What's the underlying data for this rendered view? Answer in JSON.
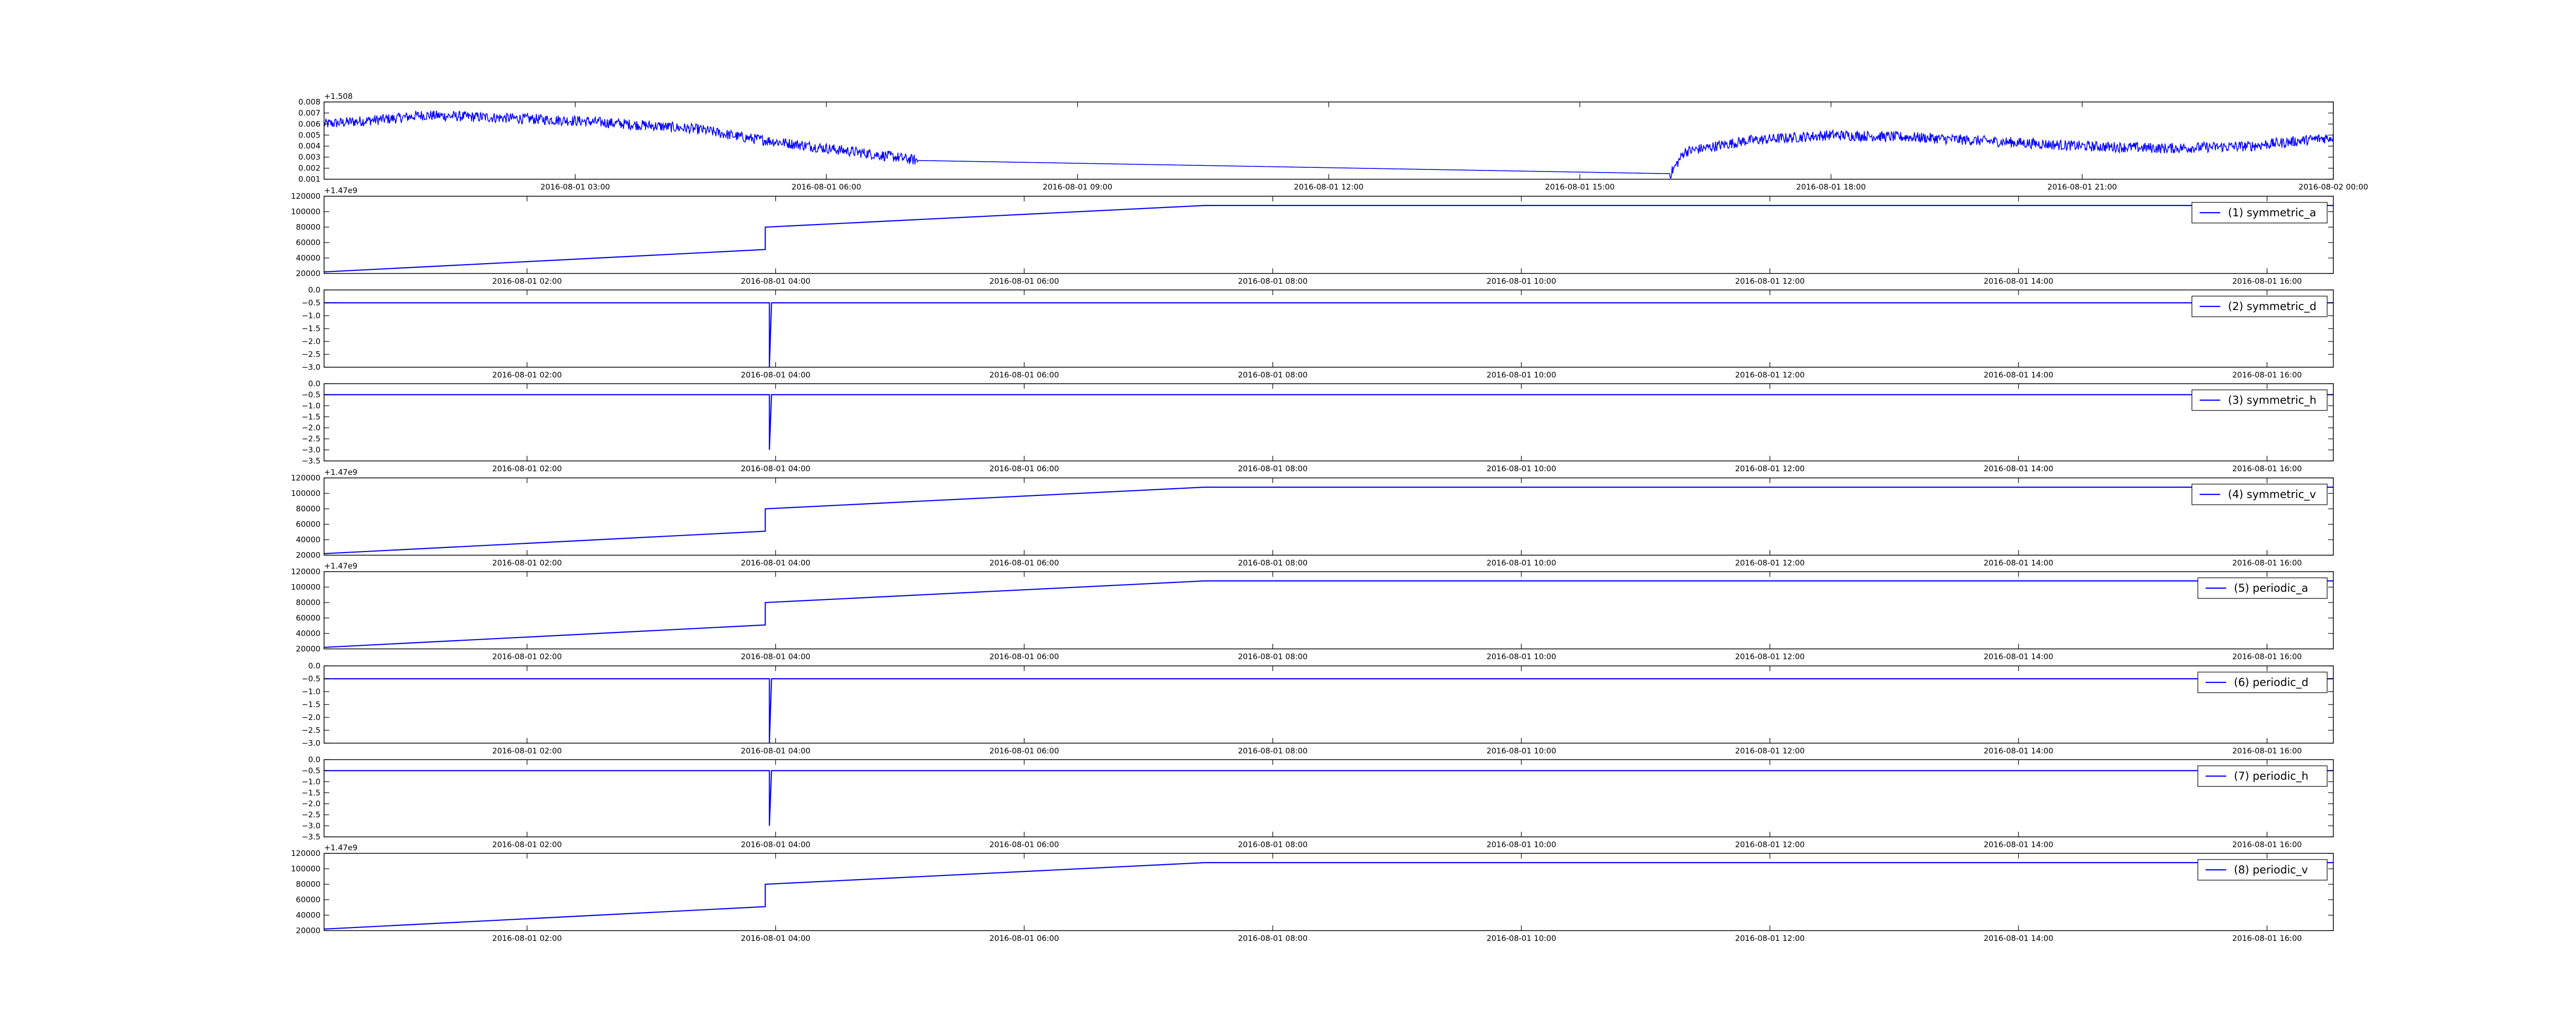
{
  "page": {
    "background": "#ffffff"
  },
  "style": {
    "line_color": "#0000ff",
    "axes_color": "#000000"
  },
  "chart_data": [
    {
      "type": "line",
      "y_offset_label": "+1.508",
      "ylim": [
        0.001,
        0.008
      ],
      "yticks": [
        0.001,
        0.002,
        0.003,
        0.004,
        0.005,
        0.006,
        0.007,
        0.008
      ],
      "ytick_labels": [
        "0.001",
        "0.002",
        "0.003",
        "0.004",
        "0.005",
        "0.006",
        "0.007",
        "0.008"
      ],
      "xlim": [
        "2016-08-01T00:00",
        "2016-08-02T00:00"
      ],
      "xticks": [
        "2016-08-01T03:00",
        "2016-08-01T06:00",
        "2016-08-01T09:00",
        "2016-08-01T12:00",
        "2016-08-01T15:00",
        "2016-08-01T18:00",
        "2016-08-01T21:00",
        "2016-08-02T00:00"
      ],
      "xtick_labels": [
        "2016-08-01 03:00",
        "2016-08-01 06:00",
        "2016-08-01 09:00",
        "2016-08-01 12:00",
        "2016-08-01 15:00",
        "2016-08-01 18:00",
        "2016-08-01 21:00",
        "2016-08-02 00:00"
      ],
      "noisy": true,
      "noise_amplitude": 0.0006,
      "points": [
        [
          "2016-08-01T00:00",
          0.006
        ],
        [
          "2016-08-01T00:50",
          0.0065
        ],
        [
          "2016-08-01T01:10",
          0.0068
        ],
        [
          "2016-08-01T02:00",
          0.0066
        ],
        [
          "2016-08-01T03:00",
          0.0063
        ],
        [
          "2016-08-01T04:00",
          0.0058
        ],
        [
          "2016-08-01T04:30",
          0.0055
        ],
        [
          "2016-08-01T05:00",
          0.0048
        ],
        [
          "2016-08-01T06:00",
          0.0038
        ],
        [
          "2016-08-01T06:50",
          0.003
        ],
        [
          "2016-08-01T07:05",
          0.0027
        ],
        [
          "2016-08-01T16:05",
          0.0015
        ],
        [
          "2016-08-01T16:15",
          0.0035
        ],
        [
          "2016-08-01T17:00",
          0.0045
        ],
        [
          "2016-08-01T18:00",
          0.005
        ],
        [
          "2016-08-01T19:00",
          0.0048
        ],
        [
          "2016-08-01T20:00",
          0.0044
        ],
        [
          "2016-08-01T21:00",
          0.004
        ],
        [
          "2016-08-01T22:00",
          0.0038
        ],
        [
          "2016-08-01T23:00",
          0.004
        ],
        [
          "2016-08-02T00:00",
          0.0048
        ]
      ],
      "flat_segment": [
        "2016-08-01T07:05",
        "2016-08-01T16:05"
      ]
    },
    {
      "type": "line",
      "legend": "(1) symmetric_a",
      "y_offset_label": "+1.47e9",
      "ylim": [
        20000,
        120000
      ],
      "yticks": [
        20000,
        40000,
        60000,
        80000,
        100000,
        120000
      ],
      "ytick_labels": [
        "20000",
        "40000",
        "60000",
        "80000",
        "100000",
        "120000"
      ],
      "xlim": [
        "2016-08-01T00:22",
        "2016-08-01T16:32"
      ],
      "xticks": [
        "2016-08-01T02:00",
        "2016-08-01T04:00",
        "2016-08-01T06:00",
        "2016-08-01T08:00",
        "2016-08-01T10:00",
        "2016-08-01T12:00",
        "2016-08-01T14:00",
        "2016-08-01T16:00"
      ],
      "xtick_labels": [
        "2016-08-01 02:00",
        "2016-08-01 04:00",
        "2016-08-01 06:00",
        "2016-08-01 08:00",
        "2016-08-01 10:00",
        "2016-08-01 12:00",
        "2016-08-01 14:00",
        "2016-08-01 16:00"
      ],
      "points": [
        [
          "2016-08-01T00:22",
          22000
        ],
        [
          "2016-08-01T03:55",
          51000
        ],
        [
          "2016-08-01T03:55",
          80000
        ],
        [
          "2016-08-01T07:27",
          108000
        ],
        [
          "2016-08-01T16:32",
          108000
        ]
      ]
    },
    {
      "type": "line",
      "legend": "(2) symmetric_d",
      "ylim": [
        -3.0,
        0.0
      ],
      "yticks": [
        0.0,
        -0.5,
        -1.0,
        -1.5,
        -2.0,
        -2.5,
        -3.0
      ],
      "ytick_labels": [
        "0.0",
        "−0.5",
        "−1.0",
        "−1.5",
        "−2.0",
        "−2.5",
        "−3.0"
      ],
      "xlim": [
        "2016-08-01T00:22",
        "2016-08-01T16:32"
      ],
      "xticks": [
        "2016-08-01T02:00",
        "2016-08-01T04:00",
        "2016-08-01T06:00",
        "2016-08-01T08:00",
        "2016-08-01T10:00",
        "2016-08-01T12:00",
        "2016-08-01T14:00",
        "2016-08-01T16:00"
      ],
      "xtick_labels": [
        "2016-08-01 02:00",
        "2016-08-01 04:00",
        "2016-08-01 06:00",
        "2016-08-01 08:00",
        "2016-08-01 10:00",
        "2016-08-01 12:00",
        "2016-08-01 14:00",
        "2016-08-01 16:00"
      ],
      "points": [
        [
          "2016-08-01T00:22",
          -0.5
        ],
        [
          "2016-08-01T03:57",
          -0.5
        ],
        [
          "2016-08-01T03:57",
          -3.0
        ],
        [
          "2016-08-01T03:58",
          -0.5
        ],
        [
          "2016-08-01T16:32",
          -0.5
        ]
      ]
    },
    {
      "type": "line",
      "legend": "(3) symmetric_h",
      "ylim": [
        -3.5,
        0.0
      ],
      "yticks": [
        0.0,
        -0.5,
        -1.0,
        -1.5,
        -2.0,
        -2.5,
        -3.0,
        -3.5
      ],
      "ytick_labels": [
        "0.0",
        "−0.5",
        "−1.0",
        "−1.5",
        "−2.0",
        "−2.5",
        "−3.0",
        "−3.5"
      ],
      "xlim": [
        "2016-08-01T00:22",
        "2016-08-01T16:32"
      ],
      "xticks": [
        "2016-08-01T02:00",
        "2016-08-01T04:00",
        "2016-08-01T06:00",
        "2016-08-01T08:00",
        "2016-08-01T10:00",
        "2016-08-01T12:00",
        "2016-08-01T14:00",
        "2016-08-01T16:00"
      ],
      "xtick_labels": [
        "2016-08-01 02:00",
        "2016-08-01 04:00",
        "2016-08-01 06:00",
        "2016-08-01 08:00",
        "2016-08-01 10:00",
        "2016-08-01 12:00",
        "2016-08-01 14:00",
        "2016-08-01 16:00"
      ],
      "points": [
        [
          "2016-08-01T00:22",
          -0.5
        ],
        [
          "2016-08-01T03:57",
          -0.5
        ],
        [
          "2016-08-01T03:57",
          -3.0
        ],
        [
          "2016-08-01T03:58",
          -0.5
        ],
        [
          "2016-08-01T16:32",
          -0.5
        ]
      ]
    },
    {
      "type": "line",
      "legend": "(4) symmetric_v",
      "y_offset_label": "+1.47e9",
      "ylim": [
        20000,
        120000
      ],
      "yticks": [
        20000,
        40000,
        60000,
        80000,
        100000,
        120000
      ],
      "ytick_labels": [
        "20000",
        "40000",
        "60000",
        "80000",
        "100000",
        "120000"
      ],
      "xlim": [
        "2016-08-01T00:22",
        "2016-08-01T16:32"
      ],
      "xticks": [
        "2016-08-01T02:00",
        "2016-08-01T04:00",
        "2016-08-01T06:00",
        "2016-08-01T08:00",
        "2016-08-01T10:00",
        "2016-08-01T12:00",
        "2016-08-01T14:00",
        "2016-08-01T16:00"
      ],
      "xtick_labels": [
        "2016-08-01 02:00",
        "2016-08-01 04:00",
        "2016-08-01 06:00",
        "2016-08-01 08:00",
        "2016-08-01 10:00",
        "2016-08-01 12:00",
        "2016-08-01 14:00",
        "2016-08-01 16:00"
      ],
      "points": [
        [
          "2016-08-01T00:22",
          22000
        ],
        [
          "2016-08-01T03:55",
          51000
        ],
        [
          "2016-08-01T03:55",
          80000
        ],
        [
          "2016-08-01T07:27",
          108000
        ],
        [
          "2016-08-01T16:32",
          108000
        ]
      ]
    },
    {
      "type": "line",
      "legend": "(5) periodic_a",
      "y_offset_label": "+1.47e9",
      "ylim": [
        20000,
        120000
      ],
      "yticks": [
        20000,
        40000,
        60000,
        80000,
        100000,
        120000
      ],
      "ytick_labels": [
        "20000",
        "40000",
        "60000",
        "80000",
        "100000",
        "120000"
      ],
      "xlim": [
        "2016-08-01T00:22",
        "2016-08-01T16:32"
      ],
      "xticks": [
        "2016-08-01T02:00",
        "2016-08-01T04:00",
        "2016-08-01T06:00",
        "2016-08-01T08:00",
        "2016-08-01T10:00",
        "2016-08-01T12:00",
        "2016-08-01T14:00",
        "2016-08-01T16:00"
      ],
      "xtick_labels": [
        "2016-08-01 02:00",
        "2016-08-01 04:00",
        "2016-08-01 06:00",
        "2016-08-01 08:00",
        "2016-08-01 10:00",
        "2016-08-01 12:00",
        "2016-08-01 14:00",
        "2016-08-01 16:00"
      ],
      "points": [
        [
          "2016-08-01T00:22",
          22000
        ],
        [
          "2016-08-01T03:55",
          51000
        ],
        [
          "2016-08-01T03:55",
          80000
        ],
        [
          "2016-08-01T07:27",
          108000
        ],
        [
          "2016-08-01T16:32",
          108000
        ]
      ]
    },
    {
      "type": "line",
      "legend": "(6) periodic_d",
      "ylim": [
        -3.0,
        0.0
      ],
      "yticks": [
        0.0,
        -0.5,
        -1.0,
        -1.5,
        -2.0,
        -2.5,
        -3.0
      ],
      "ytick_labels": [
        "0.0",
        "−0.5",
        "−1.0",
        "−1.5",
        "−2.0",
        "−2.5",
        "−3.0"
      ],
      "xlim": [
        "2016-08-01T00:22",
        "2016-08-01T16:32"
      ],
      "xticks": [
        "2016-08-01T02:00",
        "2016-08-01T04:00",
        "2016-08-01T06:00",
        "2016-08-01T08:00",
        "2016-08-01T10:00",
        "2016-08-01T12:00",
        "2016-08-01T14:00",
        "2016-08-01T16:00"
      ],
      "xtick_labels": [
        "2016-08-01 02:00",
        "2016-08-01 04:00",
        "2016-08-01 06:00",
        "2016-08-01 08:00",
        "2016-08-01 10:00",
        "2016-08-01 12:00",
        "2016-08-01 14:00",
        "2016-08-01 16:00"
      ],
      "points": [
        [
          "2016-08-01T00:22",
          -0.5
        ],
        [
          "2016-08-01T03:57",
          -0.5
        ],
        [
          "2016-08-01T03:57",
          -3.0
        ],
        [
          "2016-08-01T03:58",
          -0.5
        ],
        [
          "2016-08-01T16:32",
          -0.5
        ]
      ]
    },
    {
      "type": "line",
      "legend": "(7) periodic_h",
      "ylim": [
        -3.5,
        0.0
      ],
      "yticks": [
        0.0,
        -0.5,
        -1.0,
        -1.5,
        -2.0,
        -2.5,
        -3.0,
        -3.5
      ],
      "ytick_labels": [
        "0.0",
        "−0.5",
        "−1.0",
        "−1.5",
        "−2.0",
        "−2.5",
        "−3.0",
        "−3.5"
      ],
      "xlim": [
        "2016-08-01T00:22",
        "2016-08-01T16:32"
      ],
      "xticks": [
        "2016-08-01T02:00",
        "2016-08-01T04:00",
        "2016-08-01T06:00",
        "2016-08-01T08:00",
        "2016-08-01T10:00",
        "2016-08-01T12:00",
        "2016-08-01T14:00",
        "2016-08-01T16:00"
      ],
      "xtick_labels": [
        "2016-08-01 02:00",
        "2016-08-01 04:00",
        "2016-08-01 06:00",
        "2016-08-01 08:00",
        "2016-08-01 10:00",
        "2016-08-01 12:00",
        "2016-08-01 14:00",
        "2016-08-01 16:00"
      ],
      "points": [
        [
          "2016-08-01T00:22",
          -0.5
        ],
        [
          "2016-08-01T03:57",
          -0.5
        ],
        [
          "2016-08-01T03:57",
          -3.0
        ],
        [
          "2016-08-01T03:58",
          -0.5
        ],
        [
          "2016-08-01T16:32",
          -0.5
        ]
      ]
    },
    {
      "type": "line",
      "legend": "(8) periodic_v",
      "y_offset_label": "+1.47e9",
      "ylim": [
        20000,
        120000
      ],
      "yticks": [
        20000,
        40000,
        60000,
        80000,
        100000,
        120000
      ],
      "ytick_labels": [
        "20000",
        "40000",
        "60000",
        "80000",
        "100000",
        "120000"
      ],
      "xlim": [
        "2016-08-01T00:22",
        "2016-08-01T16:32"
      ],
      "xticks": [
        "2016-08-01T02:00",
        "2016-08-01T04:00",
        "2016-08-01T06:00",
        "2016-08-01T08:00",
        "2016-08-01T10:00",
        "2016-08-01T12:00",
        "2016-08-01T14:00",
        "2016-08-01T16:00"
      ],
      "xtick_labels": [
        "2016-08-01 02:00",
        "2016-08-01 04:00",
        "2016-08-01 06:00",
        "2016-08-01 08:00",
        "2016-08-01 10:00",
        "2016-08-01 12:00",
        "2016-08-01 14:00",
        "2016-08-01 16:00"
      ],
      "points": [
        [
          "2016-08-01T00:22",
          22000
        ],
        [
          "2016-08-01T03:55",
          51000
        ],
        [
          "2016-08-01T03:55",
          80000
        ],
        [
          "2016-08-01T07:27",
          108000
        ],
        [
          "2016-08-01T16:32",
          108000
        ]
      ]
    }
  ]
}
